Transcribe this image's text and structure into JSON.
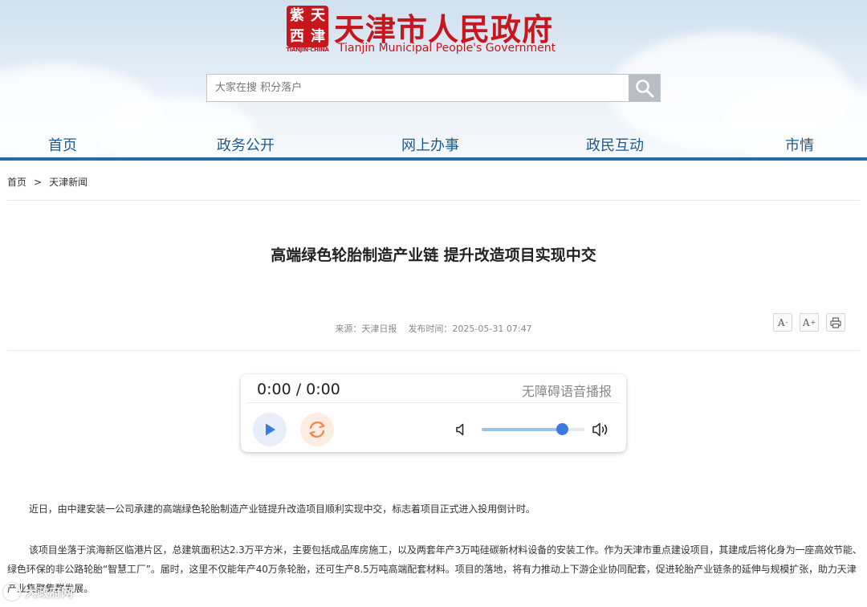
{
  "header": {
    "seal_chars": [
      "天",
      "津",
      "紫",
      "西"
    ],
    "seal_caption": "TIANJIN·CHINA",
    "site_title": "天津市人民政府",
    "site_subtitle": "Tianjin Municipal People's Government",
    "search": {
      "placeholder": "大家在搜 积分落户",
      "button_icon": "search-icon"
    },
    "nav": [
      "首页",
      "政务公开",
      "网上办事",
      "政民互动",
      "市情"
    ]
  },
  "breadcrumb": {
    "items": [
      "首页",
      "天津新闻"
    ],
    "separator": ">"
  },
  "article": {
    "title": "高端绿色轮胎制造产业链 提升改造项目实现中交",
    "source": "来源：天津日报",
    "publish_time": "发布时间：2025-05-31 07:47",
    "tools": {
      "font_decrease": "A",
      "font_decrease_sup": "-",
      "font_increase": "A",
      "font_increase_sup": "+",
      "print_icon": "print-icon"
    },
    "paragraphs": [
      "近日，由中建安装一公司承建的高端绿色轮胎制造产业链提升改造项目顺利实现中交，标志着项目正式进入投用倒计时。",
      "该项目坐落于滨海新区临港片区，总建筑面积达2.3万平方米，主要包括成品库房施工，以及两套年产3万吨硅碳新材料设备的安装工作。作为天津市重点建设项目，其建成后将化身为一座高效节能、绿色环保的非公路轮胎“智慧工厂”。届时，这里不仅能年产40万条轮胎，还可生产8.5万吨高端配套材料。项目的落地，将有力推动上下游企业协同配套，促进轮胎产业链条的延伸与规模扩张，助力天津产业集聚集群发展。"
    ]
  },
  "player": {
    "time": "0:00 / 0:00",
    "label": "无障碍语音播报",
    "volume_fraction": 0.78,
    "play_icon": "play-icon",
    "replay_icon": "replay-icon",
    "volume_low_icon": "volume-low-icon",
    "volume_high_icon": "volume-high-icon"
  },
  "watermark": {
    "text": "大政府网"
  },
  "colors": {
    "brand_red": "#c8161d",
    "nav_blue": "#1f5a8e",
    "nav_line": "#2a6aa0",
    "player_accent": "#3c7ae0"
  }
}
